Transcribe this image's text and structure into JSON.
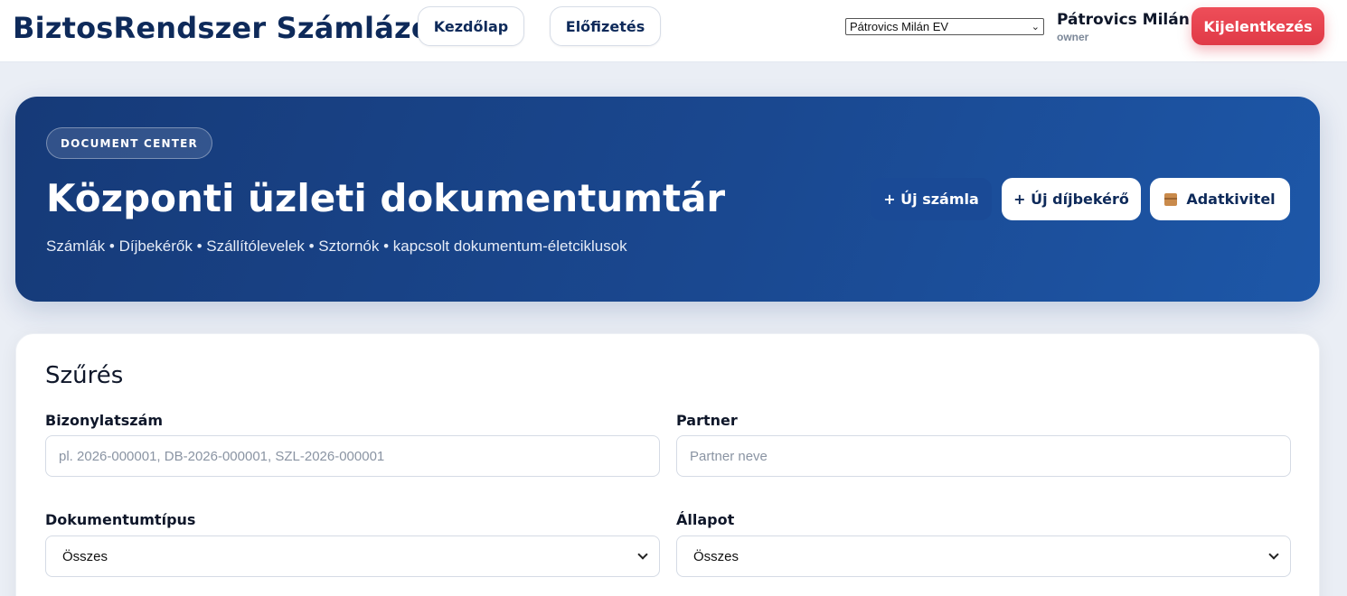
{
  "header": {
    "brand": "BiztosRendszer Számlázó",
    "nav": [
      {
        "label": "Kezdőlap"
      },
      {
        "label": "Előfizetés"
      }
    ],
    "company_select": {
      "value": "Pátrovics Milán EV"
    },
    "user": {
      "name": "Pátrovics Milán",
      "role": "owner"
    },
    "logout_label": "Kijelentkezés"
  },
  "hero": {
    "badge": "DOCUMENT CENTER",
    "title": "Központi üzleti dokumentumtár",
    "subtitle": "Számlák • Díjbekérők • Szállítólevelek • Sztornók • kapcsolt dokumentum-életciklusok",
    "buttons": {
      "new_invoice": "+ Új számla",
      "new_proforma": "+ Új díjbekérő",
      "export": "Adatkivitel"
    },
    "export_icon": "package-icon"
  },
  "filter": {
    "title": "Szűrés",
    "doc_number": {
      "label": "Bizonylatszám",
      "placeholder": "pl. 2026-000001, DB-2026-000001, SZL-2026-000001",
      "value": ""
    },
    "partner": {
      "label": "Partner",
      "placeholder": "Partner neve",
      "value": ""
    },
    "doc_type": {
      "label": "Dokumentumtípus",
      "value": "Összes"
    },
    "status": {
      "label": "Állapot",
      "value": "Összes"
    }
  },
  "colors": {
    "brand": "#0e2a5a",
    "hero_start": "#163a78",
    "hero_end": "#1d57a8",
    "danger": "#e03a47"
  }
}
